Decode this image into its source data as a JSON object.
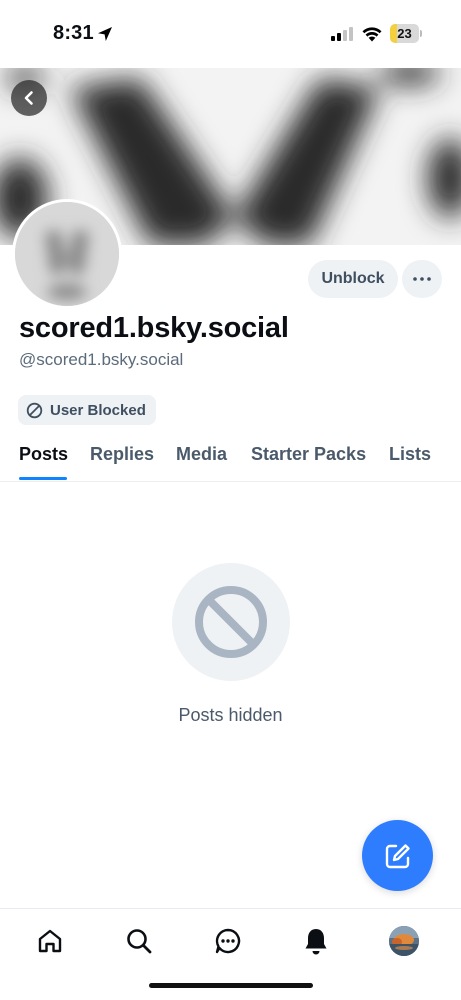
{
  "status_bar": {
    "time": "8:31",
    "battery": "23",
    "battery_level": 0.23,
    "battery_color": "#f4d03f"
  },
  "profile": {
    "display_name": "scored1.bsky.social",
    "handle": "@scored1.bsky.social",
    "unblock_label": "Unblock",
    "blocked_badge": "User Blocked"
  },
  "tabs": [
    {
      "label": "Posts",
      "active": true
    },
    {
      "label": "Replies",
      "active": false
    },
    {
      "label": "Media",
      "active": false
    },
    {
      "label": "Starter Packs",
      "active": false
    },
    {
      "label": "Lists",
      "active": false
    }
  ],
  "empty_state": {
    "message": "Posts hidden",
    "icon": "block-icon"
  },
  "nav": {
    "items": [
      "home-icon",
      "search-icon",
      "chat-icon",
      "bell-icon",
      "profile-avatar"
    ]
  },
  "colors": {
    "accent": "#1083fe",
    "fab": "#2f7dff",
    "muted_bg": "#eef2f5"
  }
}
